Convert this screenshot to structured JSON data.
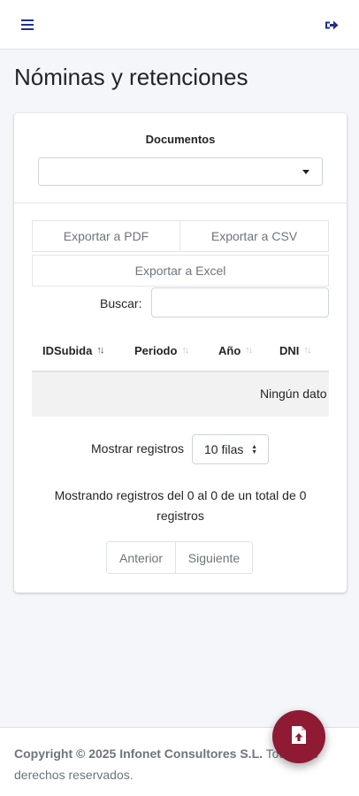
{
  "header": {
    "menu_icon": "hamburger-menu-icon",
    "logout_icon": "sign-out-icon",
    "accent": "#1f2f8f"
  },
  "page": {
    "title": "Nóminas y retenciones"
  },
  "filter": {
    "label": "Documentos",
    "selected": ""
  },
  "export": {
    "pdf": "Exportar a PDF",
    "csv": "Exportar a CSV",
    "excel": "Exportar a Excel"
  },
  "search": {
    "label": "Buscar:",
    "value": ""
  },
  "table": {
    "columns": [
      {
        "label": "IDSubida",
        "sort": "asc"
      },
      {
        "label": "Periodo",
        "sort": "none"
      },
      {
        "label": "Año",
        "sort": "none"
      },
      {
        "label": "DNI",
        "sort": "none"
      }
    ],
    "empty_text": "Ningún dato"
  },
  "length": {
    "label": "Mostrar registros",
    "selected": "10 filas"
  },
  "info": "Mostrando registros del 0 al 0 de un total de 0 registros",
  "pagination": {
    "prev": "Anterior",
    "next": "Siguiente"
  },
  "footer": {
    "brand": "Copyright © 2025 Infonet Consultores S.L.",
    "rest": "Todos los derechos reservados."
  },
  "fab": {
    "icon": "file-upload-icon",
    "color": "#8e1a33"
  }
}
